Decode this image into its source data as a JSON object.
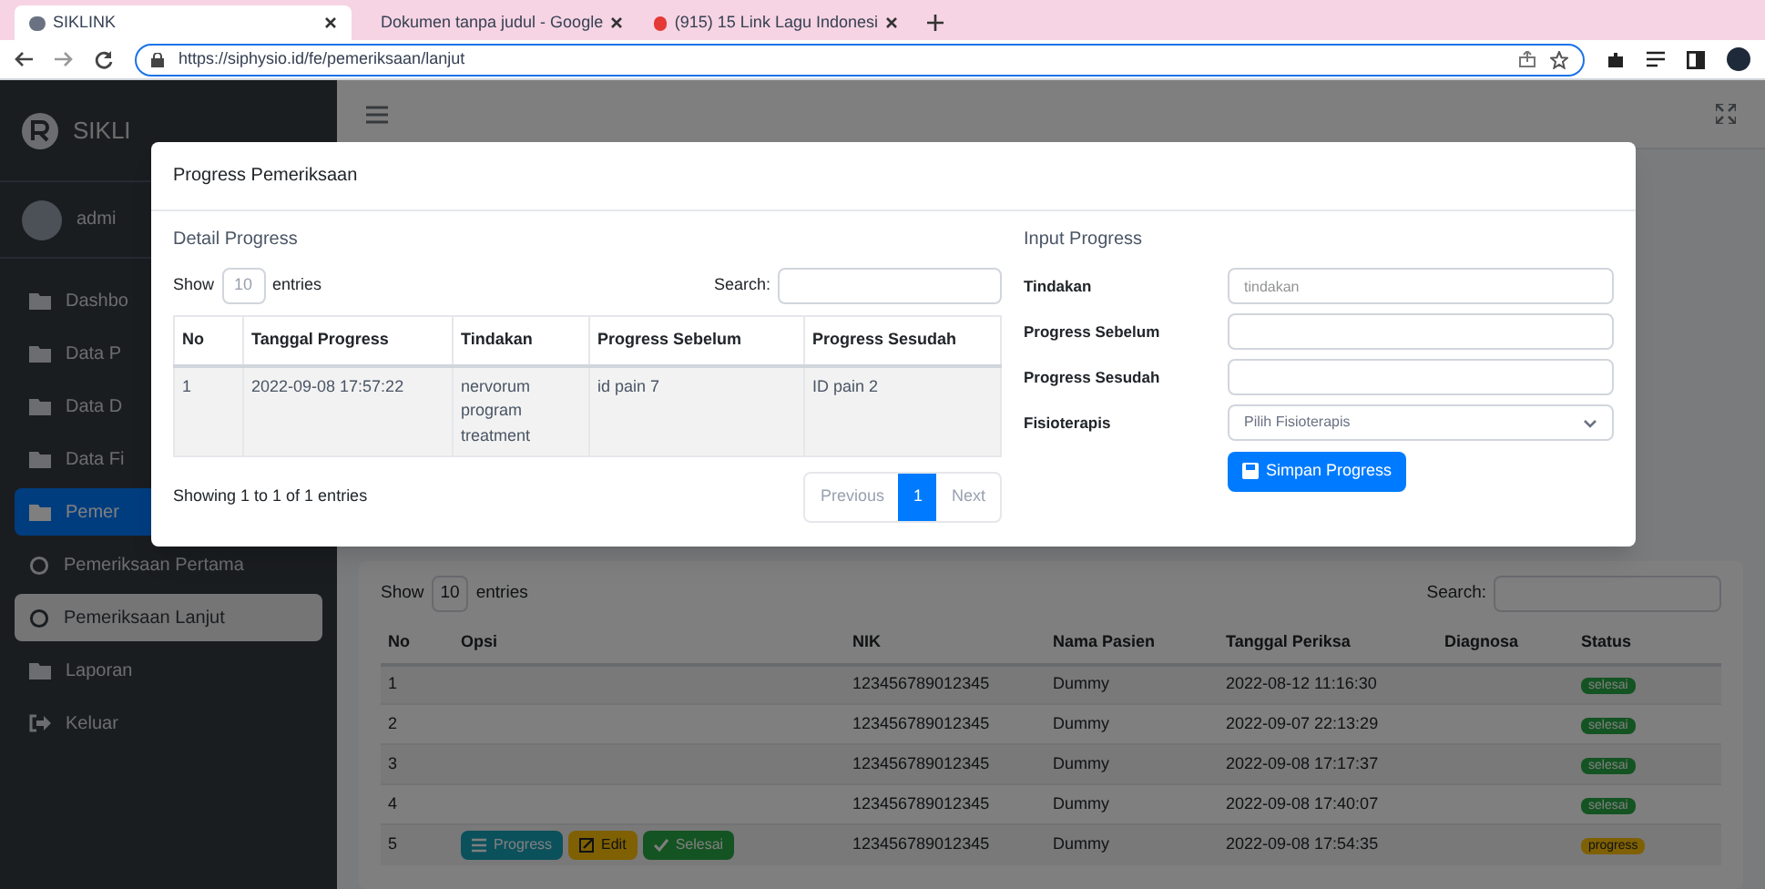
{
  "browser": {
    "tabs": [
      {
        "title": "SIKLINK",
        "selected": true
      },
      {
        "title": "Dokumen tanpa judul - Google",
        "selected": false
      },
      {
        "title": "(915) 15 Link Lagu Indonesi",
        "selected": false
      }
    ],
    "url": "https://siphysio.id/fe/pemeriksaan/lanjut"
  },
  "sidebar": {
    "brand": "SIKLI",
    "user": "admi",
    "items": [
      {
        "label": "Dashbo",
        "kind": "folder",
        "selected": false
      },
      {
        "label": "Data P",
        "kind": "folder",
        "selected": false
      },
      {
        "label": "Data D",
        "kind": "folder",
        "selected": false
      },
      {
        "label": "Data Fi",
        "kind": "folder",
        "selected": false
      },
      {
        "label": "Pemer",
        "kind": "folder",
        "selected": true
      },
      {
        "label": "Pemeriksaan Pertama",
        "kind": "circle",
        "selected": false
      },
      {
        "label": "Pemeriksaan Lanjut",
        "kind": "circle",
        "selected": true
      },
      {
        "label": "Laporan",
        "kind": "folder",
        "selected": false
      },
      {
        "label": "Keluar",
        "kind": "exit",
        "selected": false
      }
    ]
  },
  "main": {
    "show_label": "Show",
    "length": "10",
    "entries_label": "entries",
    "search_label": "Search:",
    "columns": [
      "No",
      "Opsi",
      "NIK",
      "Nama Pasien",
      "Tanggal Periksa",
      "Diagnosa",
      "Status"
    ],
    "rows": [
      {
        "no": "1",
        "nik": "123456789012345",
        "nama": "Dummy",
        "tanggal": "2022-08-12 11:16:30",
        "status": {
          "label": "selesai",
          "kind": "done"
        },
        "actions": []
      },
      {
        "no": "2",
        "nik": "123456789012345",
        "nama": "Dummy",
        "tanggal": "2022-09-07 22:13:29",
        "status": {
          "label": "selesai",
          "kind": "done"
        },
        "actions": []
      },
      {
        "no": "3",
        "nik": "123456789012345",
        "nama": "Dummy",
        "tanggal": "2022-09-08 17:17:37",
        "status": {
          "label": "selesai",
          "kind": "done"
        },
        "actions": []
      },
      {
        "no": "4",
        "nik": "123456789012345",
        "nama": "Dummy",
        "tanggal": "2022-09-08 17:40:07",
        "status": {
          "label": "selesai",
          "kind": "done"
        },
        "actions": []
      },
      {
        "no": "5",
        "nik": "123456789012345",
        "nama": "Dummy",
        "tanggal": "2022-09-08 17:54:35",
        "status": {
          "label": "progress",
          "kind": "progress"
        },
        "actions": [
          {
            "label": "Progress",
            "kind": "progress"
          },
          {
            "label": "Edit",
            "kind": "edit"
          },
          {
            "label": "Selesai",
            "kind": "done"
          }
        ]
      }
    ]
  },
  "modal": {
    "title": "Progress Pemeriksaan",
    "detail_title": "Detail Progress",
    "show_label": "Show",
    "length": "10",
    "entries_label": "entries",
    "search_label": "Search:",
    "columns": [
      "No",
      "Tanggal Progress",
      "Tindakan",
      "Progress Sebelum",
      "Progress Sesudah"
    ],
    "rows": [
      [
        "1",
        "2022-09-08 17:57:22",
        "nervorum program treatment",
        "id pain 7",
        "ID pain 2"
      ]
    ],
    "info": "Showing 1 to 1 of 1 entries",
    "pagination": [
      {
        "label": "Previous",
        "selected": false
      },
      {
        "label": "1",
        "selected": true
      },
      {
        "label": "Next",
        "selected": false
      }
    ],
    "input_title": "Input Progress",
    "fields": [
      {
        "label": "Tindakan",
        "kind": "text",
        "placeholder": "tindakan"
      },
      {
        "label": "Progress Sebelum",
        "kind": "text"
      },
      {
        "label": "Progress Sesudah",
        "kind": "text"
      },
      {
        "label": "Fisioterapis",
        "kind": "select",
        "value": "Pilih Fisioterapis"
      }
    ],
    "submit": "Simpan Progress"
  }
}
